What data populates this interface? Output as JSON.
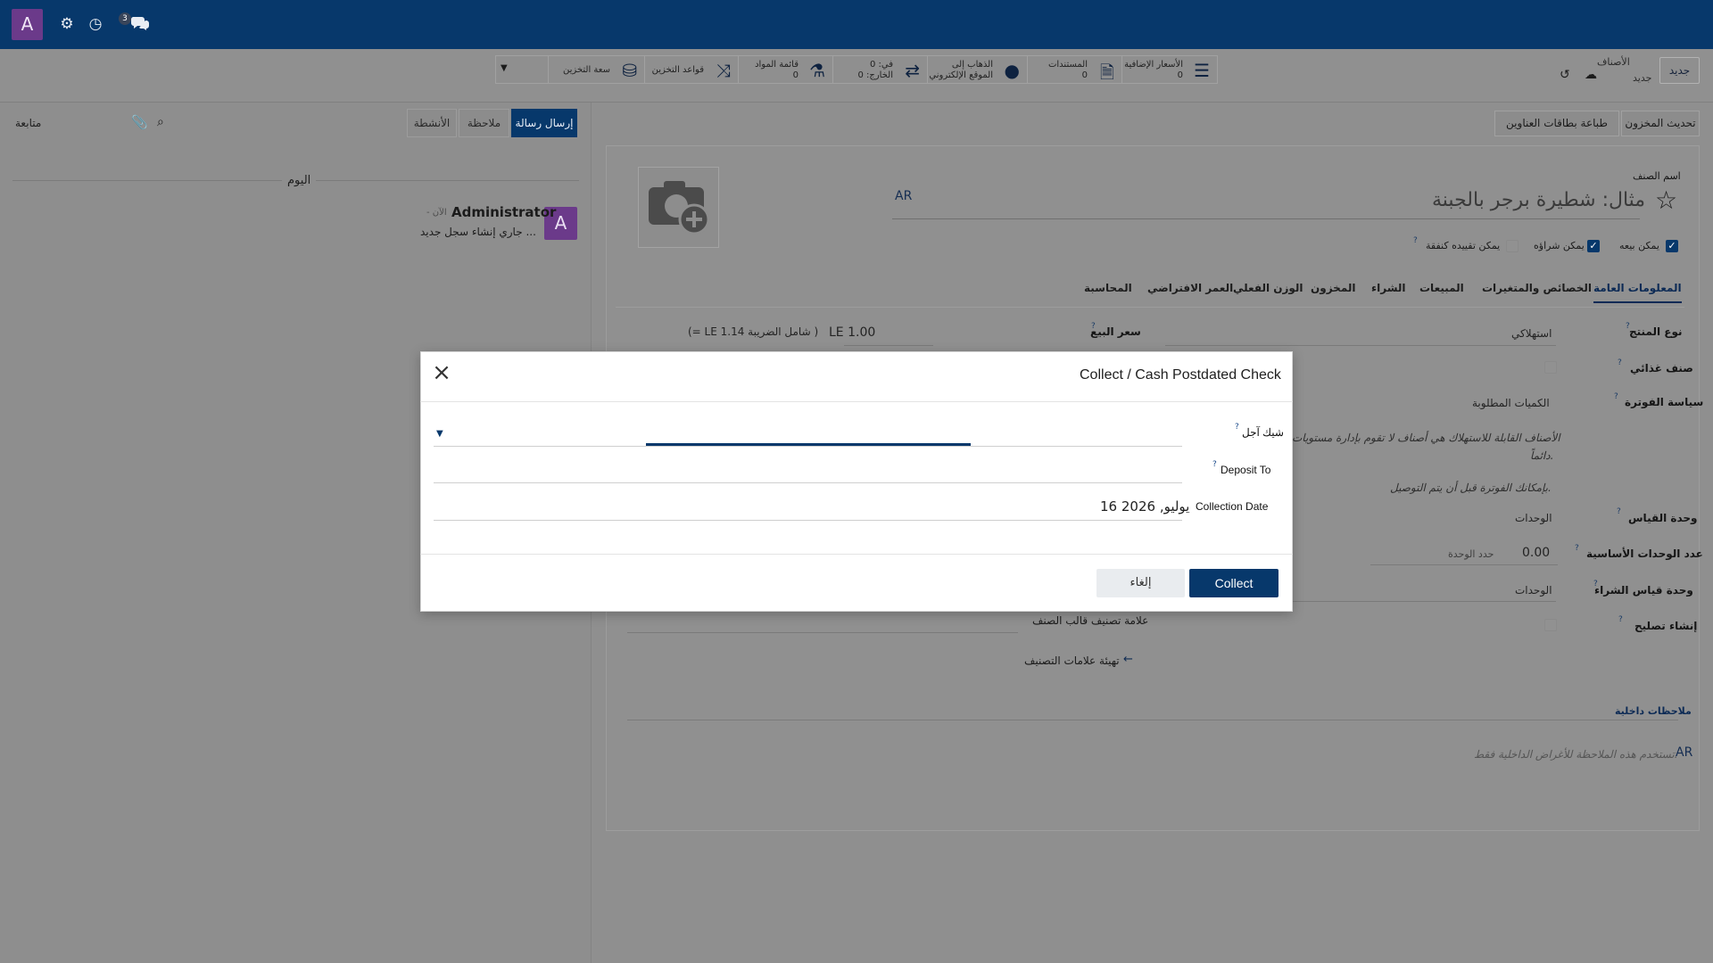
{
  "topbar": {
    "user_initial": "A",
    "chat_badge": "3"
  },
  "control_panel": {
    "new_button": "جديد",
    "breadcrumb_parent": "الأصناف",
    "breadcrumb_current": "جديد",
    "smart_buttons": [
      {
        "label": "الأسعار الإضافية",
        "value": "0",
        "icon": "list-icon"
      },
      {
        "label": "المستندات",
        "value": "0",
        "icon": "document-icon"
      },
      {
        "label": "الذهاب إلى",
        "value": "الموقع الإلكتروني",
        "icon": "globe-icon"
      },
      {
        "label": "في: 0",
        "value": "الخارج: 0",
        "icon": "arrows-icon"
      },
      {
        "label": "قائمة المواد",
        "value": "0",
        "icon": "flask-icon"
      },
      {
        "label": "قواعد التخزين",
        "value": "",
        "icon": "shuffle-icon"
      },
      {
        "label": "سعة التخزين",
        "value": "",
        "icon": "cubes-icon"
      }
    ]
  },
  "chatter": {
    "send_message": "إرسال رسالة",
    "log_note": "ملاحظة",
    "activities": "الأنشطة",
    "follow": "متابعة",
    "today": "اليوم",
    "message": {
      "author": "Administrator",
      "time": "- الآن",
      "body": "جاري إنشاء سجل جديد ...",
      "avatar": "A"
    }
  },
  "form": {
    "action_buttons": [
      "تحديث المخزون",
      "طباعة بطاقات العناوين"
    ],
    "name_label": "اسم الصنف",
    "name_placeholder": "مثال: شطيرة برجر بالجبنة",
    "lang_tag": "AR",
    "checkboxes": [
      {
        "label": "يمكن بيعه",
        "checked": true
      },
      {
        "label": "يمكن شراؤه",
        "checked": true
      },
      {
        "label": "يمكن تقييده كنفقة",
        "checked": false
      }
    ],
    "tabs": [
      "المعلومات العامة",
      "الخصائص والمتغيرات",
      "المبيعات",
      "الشراء",
      "المخزون",
      "الوزن الفعلي",
      "العمر الافتراضي",
      "المحاسبة"
    ],
    "fields": {
      "product_type_label": "نوع المنتج",
      "product_type_value": "استهلاكي",
      "sales_price_label": "سعر البيع",
      "sales_price_value": "LE 1.00",
      "sales_price_tax": "(= LE 1.14 شامل الضريبة )",
      "food_label": "صنف غذائي",
      "invoice_policy_label": "سياسة الفوترة",
      "invoice_policy_value": "الكميات المطلوبة",
      "consumable_note": "الأصناف القابلة للاستهلاك هي أصناف لا تقوم بإدارة مستويات",
      "consumable_note2": "دائماً.",
      "invoice_note": "بإمكانك الفوترة قبل أن يتم التوصيل.",
      "uom_label": "وحدة القياس",
      "uom_value": "الوحدات",
      "base_units_label": "عدد الوحدات الأساسية",
      "base_units_value": "0.00",
      "base_units_unit": "حدد الوحدة",
      "purchase_uom_label": "وحدة قياس الشراء",
      "purchase_uom_value": "الوحدات",
      "create_repair_label": "إنشاء تصليح",
      "template_tag_label": "علامة تصنيف قالب الصنف",
      "config_tags_link": "تهيئة علامات التصنيف",
      "internal_notes_label": "ملاحظات داخلية",
      "internal_notes_placeholder": "تستخدم هذه الملاحظة للأغراض الداخلية فقط.",
      "internal_notes_lang": "AR"
    }
  },
  "dialog": {
    "title": "Collect / Cash Postdated Check",
    "check_label": "شيك آجل",
    "deposit_label": "Deposit To",
    "collection_date_label": "Collection Date",
    "collection_date_value": "16 يوليو, 2026",
    "collect_button": "Collect",
    "cancel_button": "إلغاء"
  }
}
